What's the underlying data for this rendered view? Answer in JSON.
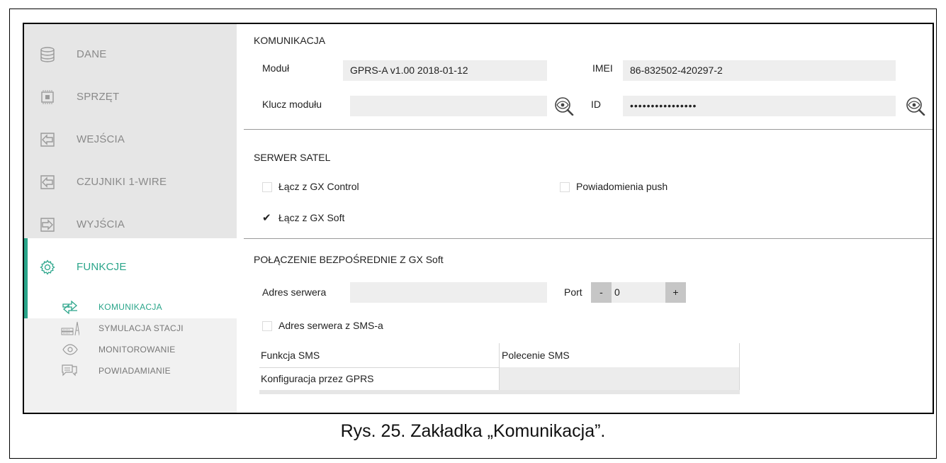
{
  "sidebar": {
    "items": [
      {
        "label": "DANE",
        "icon": "database-icon"
      },
      {
        "label": "SPRZĘT",
        "icon": "hardware-chip-icon"
      },
      {
        "label": "WEJŚCIA",
        "icon": "input-arrow-icon"
      },
      {
        "label": "CZUJNIKI 1-WIRE",
        "icon": "input-arrow-icon"
      },
      {
        "label": "WYJŚCIA",
        "icon": "output-arrow-icon"
      },
      {
        "label": "FUNKCJE",
        "icon": "gear-icon",
        "active": true
      }
    ],
    "subitems": [
      {
        "label": "KOMUNIKACJA",
        "icon": "communication-arrows-icon",
        "active": true
      },
      {
        "label": "SYMULACJA STACJI",
        "icon": "station-simulation-icon"
      },
      {
        "label": "MONITOROWANIE",
        "icon": "eye-icon"
      },
      {
        "label": "POWIADAMIANIE",
        "icon": "chat-bubble-icon"
      }
    ]
  },
  "communication": {
    "title": "KOMUNIKACJA",
    "module_label": "Moduł",
    "module_value": "GPRS-A v1.00 2018-01-12",
    "imei_label": "IMEI",
    "imei_value": "86-832502-420297-2",
    "module_key_label": "Klucz modułu",
    "module_key_value": "",
    "id_label": "ID",
    "id_value": "••••••••••••••••"
  },
  "satel_server": {
    "title": "SERWER SATEL",
    "gx_control_label": "Łącz z GX Control",
    "gx_control_checked": false,
    "push_label": "Powiadomienia push",
    "push_checked": false,
    "gx_soft_label": "Łącz z GX Soft",
    "gx_soft_checked": true
  },
  "direct_connection": {
    "title": "POŁĄCZENIE BEZPOŚREDNIE Z GX Soft",
    "server_address_label": "Adres serwera",
    "server_address_value": "",
    "port_label": "Port",
    "port_minus": "-",
    "port_value": "0",
    "port_plus": "+",
    "sms_address_label": "Adres serwera z SMS-a",
    "sms_address_checked": false
  },
  "sms_table": {
    "headers": [
      "Funkcja SMS",
      "Polecenie SMS"
    ],
    "rows": [
      [
        "Konfiguracja przez GPRS",
        ""
      ]
    ]
  },
  "caption": "Rys. 25. Zakładka „Komunikacja”.",
  "colors": {
    "accent": "#2aa58a",
    "sidebar_bg": "#e6e6e6",
    "field_bg": "#eeeeee"
  }
}
